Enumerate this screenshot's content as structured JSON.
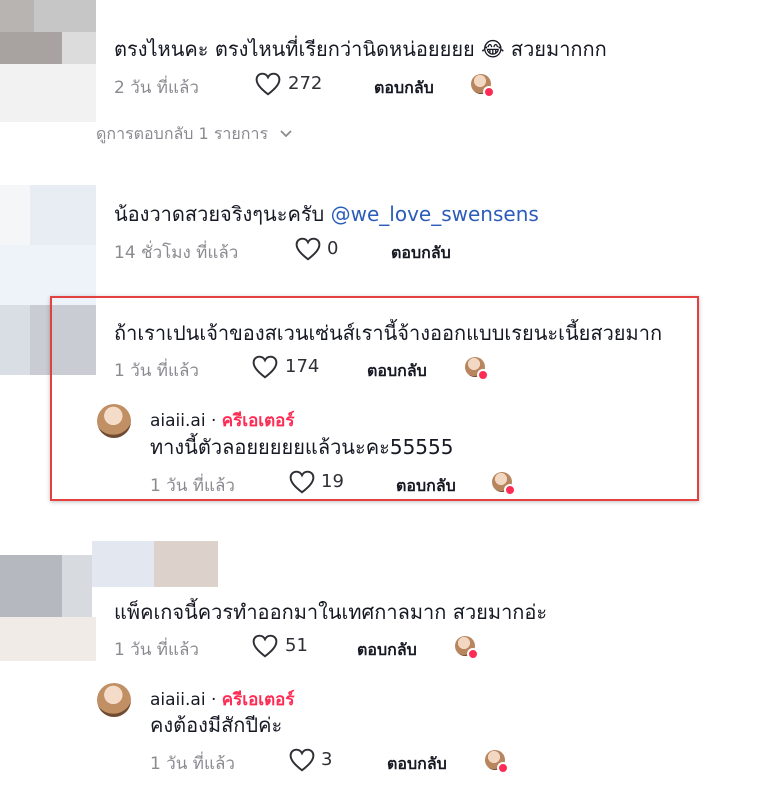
{
  "comments": [
    {
      "text": "ตรงไหนคะ ตรงไหนที่เรียกว่านิดหน่อยยยย",
      "emoji": "😂",
      "text_tail": " สวยมากกก",
      "time": "2 วัน ที่แล้ว",
      "likes": "272",
      "reply_label": "ตอบกลับ"
    },
    {
      "view_replies": "ดูการตอบกลับ 1 รายการ"
    },
    {
      "text": "น้องวาดสวยจริงๆนะครับ ",
      "mention": "@we_love_swensens",
      "time": "14 ชั่วโมง ที่แล้ว",
      "likes": "0",
      "reply_label": "ตอบกลับ"
    },
    {
      "text": "ถ้าเราเปนเจ้าของสเวนเซ่นส์เรานี้จ้างออกแบบเรยนะเนี้ยสวยมาก",
      "time": "1 วัน ที่แล้ว",
      "likes": "174",
      "reply_label": "ตอบกลับ",
      "reply": {
        "username": "aiaii.ai",
        "separator": " · ",
        "creator_label": "ครีเอเตอร์",
        "text": "ทางนี้ตัวลอยยยยยแล้วนะคะ55555",
        "time": "1 วัน ที่แล้ว",
        "likes": "19",
        "reply_label": "ตอบกลับ"
      }
    },
    {
      "text": "แพ็คเกจนี้ควรทำออกมาในเทศกาลมาก สวยมากอ่ะ",
      "time": "1 วัน ที่แล้ว",
      "likes": "51",
      "reply_label": "ตอบกลับ",
      "reply": {
        "username": "aiaii.ai",
        "separator": " · ",
        "creator_label": "ครีเอเตอร์",
        "text": "คงต้องมีสักปีค่ะ",
        "time": "1 วัน ที่แล้ว",
        "likes": "3",
        "reply_label": "ตอบกลับ"
      }
    }
  ],
  "colors": {
    "creator": "#fe2c55",
    "mention": "#2b5db9",
    "highlight_border": "#e34040",
    "meta_text": "#8a8b91"
  },
  "icons": [
    "heart-icon",
    "chevron-down-icon",
    "creator-like-avatar-icon"
  ]
}
